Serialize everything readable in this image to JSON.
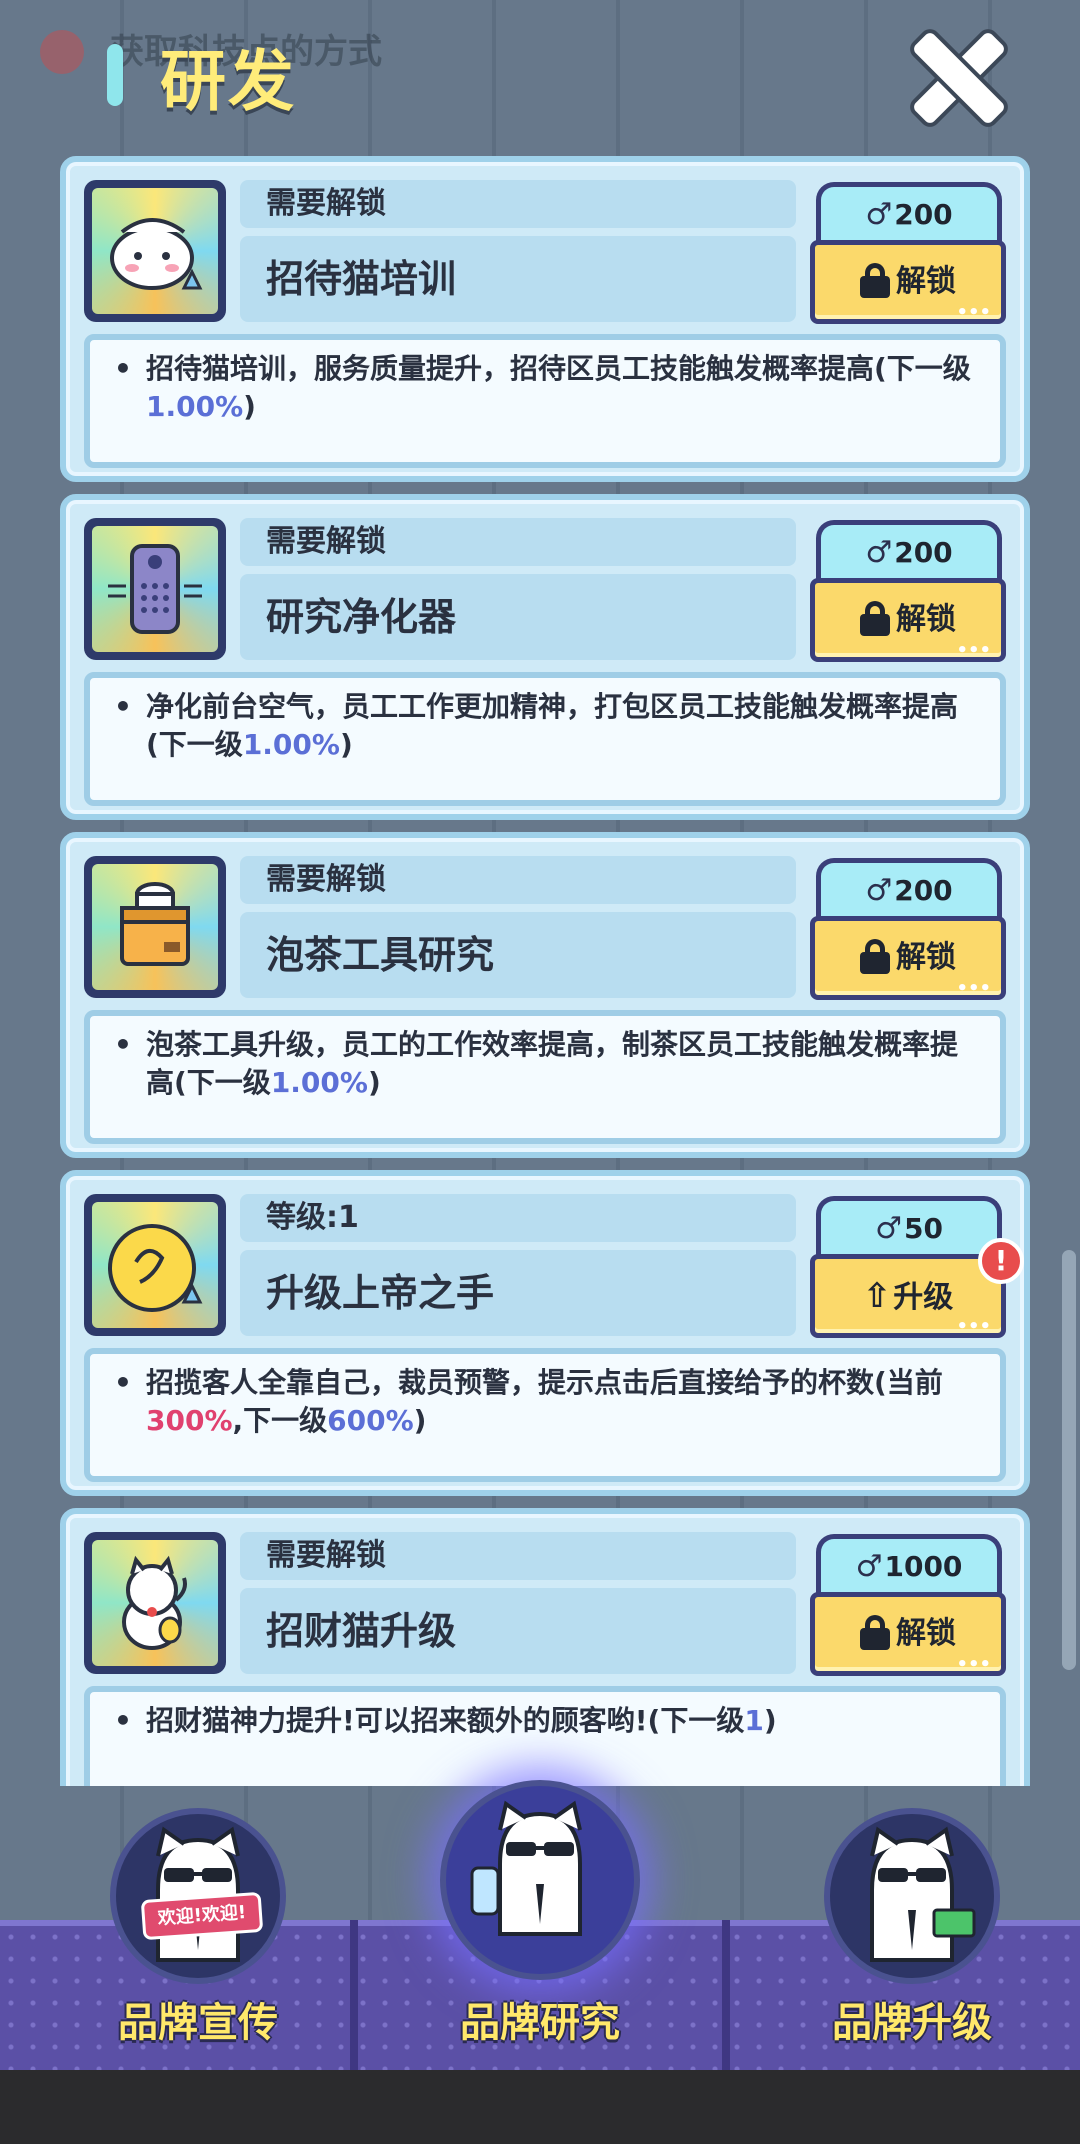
{
  "background_hint": "获取科技点的方式",
  "header": {
    "title": "研发"
  },
  "cards": [
    {
      "status": "需要解锁",
      "name": "招待猫培训",
      "cost": "200",
      "action": "解锁",
      "desc_pre": "招待猫培训，服务质量提升，招待区员工技能触发概率提高(下一级",
      "desc_hl1": "1.00%",
      "desc_mid": "",
      "desc_hl2": "",
      "desc_post": ")",
      "icon": "cat-maid-icon"
    },
    {
      "status": "需要解锁",
      "name": "研究净化器",
      "cost": "200",
      "action": "解锁",
      "desc_pre": "净化前台空气，员工工作更加精神，打包区员工技能触发概率提高(下一级",
      "desc_hl1": "1.00%",
      "desc_mid": "",
      "desc_hl2": "",
      "desc_post": ")",
      "icon": "air-purifier-icon"
    },
    {
      "status": "需要解锁",
      "name": "泡茶工具研究",
      "cost": "200",
      "action": "解锁",
      "desc_pre": "泡茶工具升级，员工的工作效率提高，制茶区员工技能触发概率提高(下一级",
      "desc_hl1": "1.00%",
      "desc_mid": "",
      "desc_hl2": "",
      "desc_post": ")",
      "icon": "tea-box-icon"
    },
    {
      "status": "等级:1",
      "name": "升级上帝之手",
      "cost": "50",
      "action": "升级",
      "desc_pre": "招揽客人全靠自己，裁员预警，提示点击后直接给予的杯数(当前",
      "desc_hl1": "300%",
      "desc_mid": ",下一级",
      "desc_hl2": "600%",
      "desc_post": ")",
      "icon": "hand-icon"
    },
    {
      "status": "需要解锁",
      "name": "招财猫升级",
      "cost": "1000",
      "action": "解锁",
      "desc_pre": "招财猫神力提升!可以招来额外的顾客哟!(下一级",
      "desc_hl1": "1",
      "desc_mid": "",
      "desc_hl2": "",
      "desc_post": ")",
      "icon": "lucky-cat-icon"
    }
  ],
  "alert_mark": "!",
  "nav": [
    {
      "label": "品牌宣传",
      "banner": "欢迎!欢迎!"
    },
    {
      "label": "品牌研究"
    },
    {
      "label": "品牌升级"
    }
  ],
  "colors": {
    "accent_yellow": "#ffec7a",
    "card_bg": "#cfeaf7",
    "button_yellow": "#fbd96b",
    "highlight_blue": "#5b6fd6",
    "highlight_red": "#e0416f",
    "nav_purple": "#5b50a6"
  }
}
